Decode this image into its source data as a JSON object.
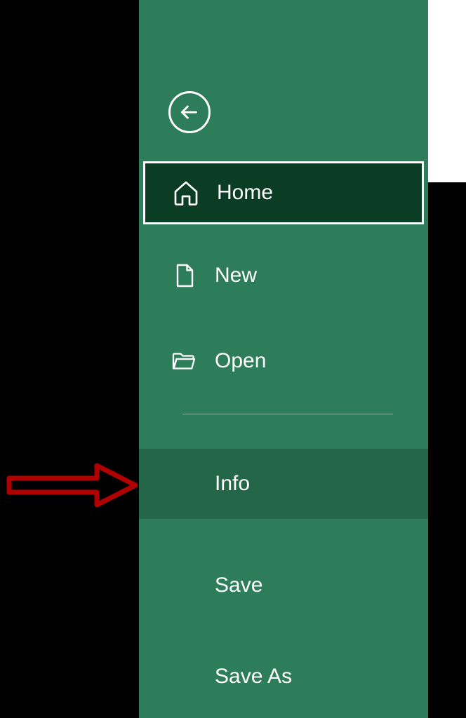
{
  "sidebar": {
    "items": {
      "home": {
        "label": "Home"
      },
      "new": {
        "label": "New"
      },
      "open": {
        "label": "Open"
      },
      "info": {
        "label": "Info"
      },
      "save": {
        "label": "Save"
      },
      "saveas": {
        "label": "Save As"
      }
    }
  }
}
